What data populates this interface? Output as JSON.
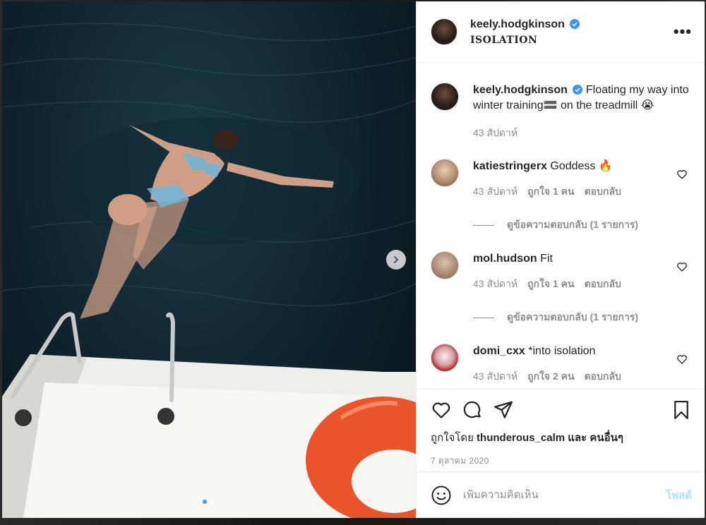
{
  "post": {
    "username": "keely.hodgkinson",
    "location": "ISOLATION",
    "more_label": "•••",
    "caption_text": "Floating my way into winter training🟰 on the treadmill 😭",
    "caption_time": "43 สัปดาห์",
    "likes_prefix": "ถูกใจโดย",
    "likes_user": "thunderous_calm",
    "likes_and": "และ",
    "likes_others": "คนอื่นๆ",
    "date": "7 ตุลาคม 2020"
  },
  "comments": [
    {
      "user": "katiestringerx",
      "text": "Goddess 🔥",
      "time": "43 สัปดาห์",
      "likes": "ถูกใจ 1 คน",
      "reply": "ตอบกลับ",
      "view_replies": "ดูข้อความตอบกลับ (1 รายการ)"
    },
    {
      "user": "mol.hudson",
      "text": "Fit",
      "time": "43 สัปดาห์",
      "likes": "ถูกใจ 1 คน",
      "reply": "ตอบกลับ",
      "view_replies": "ดูข้อความตอบกลับ (1 รายการ)"
    },
    {
      "user": "domi_cxx",
      "text": "*into isolation",
      "time": "43 สัปดาห์",
      "likes": "ถูกใจ 2 คน",
      "reply": "ตอบกลับ"
    }
  ],
  "composer": {
    "placeholder": "เพิ่มความคิดเห็น",
    "post_label": "โพสต์"
  },
  "carousel": {
    "slide_count": 2,
    "current": 1
  },
  "icons": {
    "verified": "verified-badge-icon",
    "next": "chevron-right-icon",
    "like": "heart-icon",
    "comment": "comment-bubble-icon",
    "share": "paper-plane-icon",
    "save": "bookmark-icon",
    "emoji": "smiley-icon"
  },
  "colors": {
    "verified": "#3897f0",
    "link_disabled": "#b2dffc",
    "secondary_text": "#8e8e8e",
    "border": "#efefef"
  }
}
